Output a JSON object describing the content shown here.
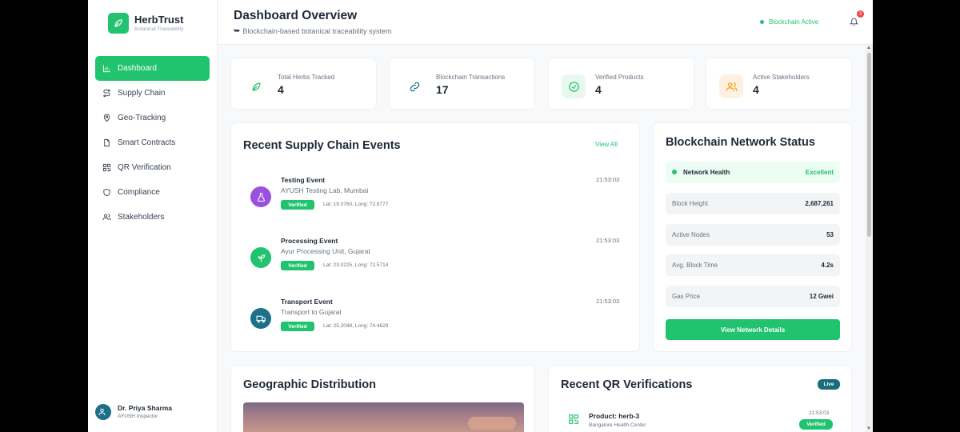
{
  "brand": {
    "name": "HerbTrust",
    "subtitle": "Botanical Traceability"
  },
  "nav": [
    {
      "label": "Dashboard",
      "icon": "bar-chart-icon",
      "active": true
    },
    {
      "label": "Supply Chain",
      "icon": "route-icon"
    },
    {
      "label": "Geo-Tracking",
      "icon": "map-pin-icon"
    },
    {
      "label": "Smart Contracts",
      "icon": "file-icon"
    },
    {
      "label": "QR Verification",
      "icon": "qr-code-icon"
    },
    {
      "label": "Compliance",
      "icon": "shield-icon"
    },
    {
      "label": "Stakeholders",
      "icon": "users-icon"
    }
  ],
  "user": {
    "name": "Dr. Priya Sharma",
    "role": "AYUSH Inspector"
  },
  "header": {
    "title": "Dashboard Overview",
    "subtitle": "Blockchain-based botanical traceability system",
    "status": "Blockchain Active",
    "notification_count": "3"
  },
  "stats": [
    {
      "label": "Total Herbs Tracked",
      "value": "4",
      "icon": "leaf-icon",
      "color": "#22c36e"
    },
    {
      "label": "Blockchain Transactions",
      "value": "17",
      "icon": "link-icon",
      "color": "#1e6f8a"
    },
    {
      "label": "Verified Products",
      "value": "4",
      "icon": "check-circle-icon",
      "color": "#22c36e"
    },
    {
      "label": "Active Stakeholders",
      "value": "4",
      "icon": "users-icon",
      "color": "#f59e0b"
    }
  ],
  "events": {
    "title": "Recent Supply Chain Events",
    "view_all": "View All",
    "items": [
      {
        "title": "Testing Event",
        "location": "AYUSH Testing Lab, Mumbai",
        "status": "Verified",
        "coords": "Lat: 19.0760, Long: 72.8777",
        "time": "21:53:03",
        "icon": "flask-icon",
        "color": "#9b51e0"
      },
      {
        "title": "Processing Event",
        "location": "Ayur Processing Unit, Gujarat",
        "status": "Verified",
        "coords": "Lat: 23.0225, Long: 72.5714",
        "time": "21:53:03",
        "icon": "sprout-icon",
        "color": "#22c36e"
      },
      {
        "title": "Transport Event",
        "location": "Transport to Gujarat",
        "status": "Verified",
        "coords": "Lat: 25.2048, Long: 74.4629",
        "time": "21:53:03",
        "icon": "truck-icon",
        "color": "#1e6f8a"
      }
    ]
  },
  "network": {
    "title": "Blockchain Network Status",
    "health_label": "Network Health",
    "health_value": "Excellent",
    "rows": [
      {
        "label": "Block Height",
        "value": "2,687,261"
      },
      {
        "label": "Active Nodes",
        "value": "53"
      },
      {
        "label": "Avg. Block Time",
        "value": "4.2s"
      },
      {
        "label": "Gas Price",
        "value": "12 Gwei"
      }
    ],
    "button": "View Network Details"
  },
  "geo": {
    "title": "Geographic Distribution"
  },
  "qr": {
    "title": "Recent QR Verifications",
    "live": "Live",
    "item": {
      "product": "Product: herb-3",
      "location": "Bangalore Health Center",
      "time": "21:53:03",
      "status": "Verified"
    }
  }
}
